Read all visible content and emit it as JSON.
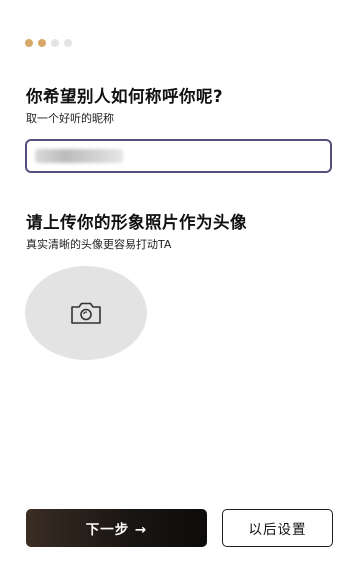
{
  "progress": {
    "total_steps": 4,
    "completed_steps": 2,
    "active_color": "#d9a868",
    "inactive_color": "#e3e3e3"
  },
  "name_section": {
    "title": "你希望别人如何称呼你呢?",
    "subtitle": "取一个好听的昵称",
    "input_value": ""
  },
  "photo_section": {
    "title": "请上传你的形象照片作为头像",
    "subtitle": "真实清晰的头像更容易打动TA",
    "upload_icon": "camera-icon"
  },
  "actions": {
    "next_label": "下一步 →",
    "later_label": "以后设置"
  },
  "colors": {
    "input_border": "#57507a",
    "primary_button": "#1a1613",
    "avatar_placeholder": "#e3e3e3"
  }
}
